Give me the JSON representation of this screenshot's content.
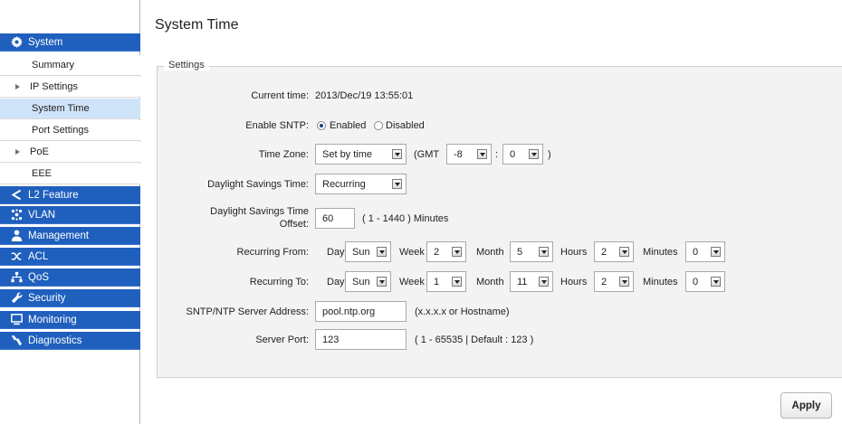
{
  "sidebar": {
    "system": "System",
    "summary": "Summary",
    "ip_settings": "IP Settings",
    "system_time": "System Time",
    "port_settings": "Port Settings",
    "poe": "PoE",
    "eee": "EEE",
    "l2_feature": "L2 Feature",
    "vlan": "VLAN",
    "management": "Management",
    "acl": "ACL",
    "qos": "QoS",
    "security": "Security",
    "monitoring": "Monitoring",
    "diagnostics": "Diagnostics"
  },
  "page": {
    "title": "System Time",
    "legend": "Settings"
  },
  "current_time": {
    "label": "Current time:",
    "value": "2013/Dec/19 13:55:01"
  },
  "sntp": {
    "label": "Enable SNTP:",
    "enabled": "Enabled",
    "disabled": "Disabled",
    "selected": "Enabled"
  },
  "timezone": {
    "label": "Time Zone:",
    "mode": "Set by time",
    "gmt_open": "(GMT",
    "hours": "-8",
    "colon": ":",
    "minutes": "0",
    "close": ")"
  },
  "dst": {
    "label": "Daylight Savings Time:",
    "value": "Recurring"
  },
  "dst_offset": {
    "label_line1": "Daylight Savings Time",
    "label_line2": "Offset:",
    "value": "60",
    "hint": "( 1 - 1440 ) Minutes"
  },
  "recurring_from": {
    "label": "Recurring From:",
    "day_label": "Day",
    "day": "Sun",
    "week_label": "Week",
    "week": "2",
    "month_label": "Month",
    "month": "5",
    "hours_label": "Hours",
    "hours": "2",
    "minutes_label": "Minutes",
    "minutes": "0"
  },
  "recurring_to": {
    "label": "Recurring To:",
    "day_label": "Day",
    "day": "Sun",
    "week_label": "Week",
    "week": "1",
    "month_label": "Month",
    "month": "11",
    "hours_label": "Hours",
    "hours": "2",
    "minutes_label": "Minutes",
    "minutes": "0"
  },
  "server_address": {
    "label": "SNTP/NTP Server Address:",
    "value": "pool.ntp.org",
    "hint": "(x.x.x.x or Hostname)"
  },
  "server_port": {
    "label": "Server Port:",
    "value": "123",
    "hint": "( 1 - 65535 | Default : 123 )"
  },
  "apply_label": "Apply",
  "colors": {
    "nav_blue": "#1f5fbd",
    "nav_active": "#cfe3f8",
    "panel_bg": "#f3f3f3"
  },
  "icons": [
    "gear-icon",
    "share-icon",
    "vlan-icon",
    "user-icon",
    "shuffle-icon",
    "hierarchy-icon",
    "wrench-icon",
    "monitor-icon",
    "diagnostics-icon"
  ]
}
